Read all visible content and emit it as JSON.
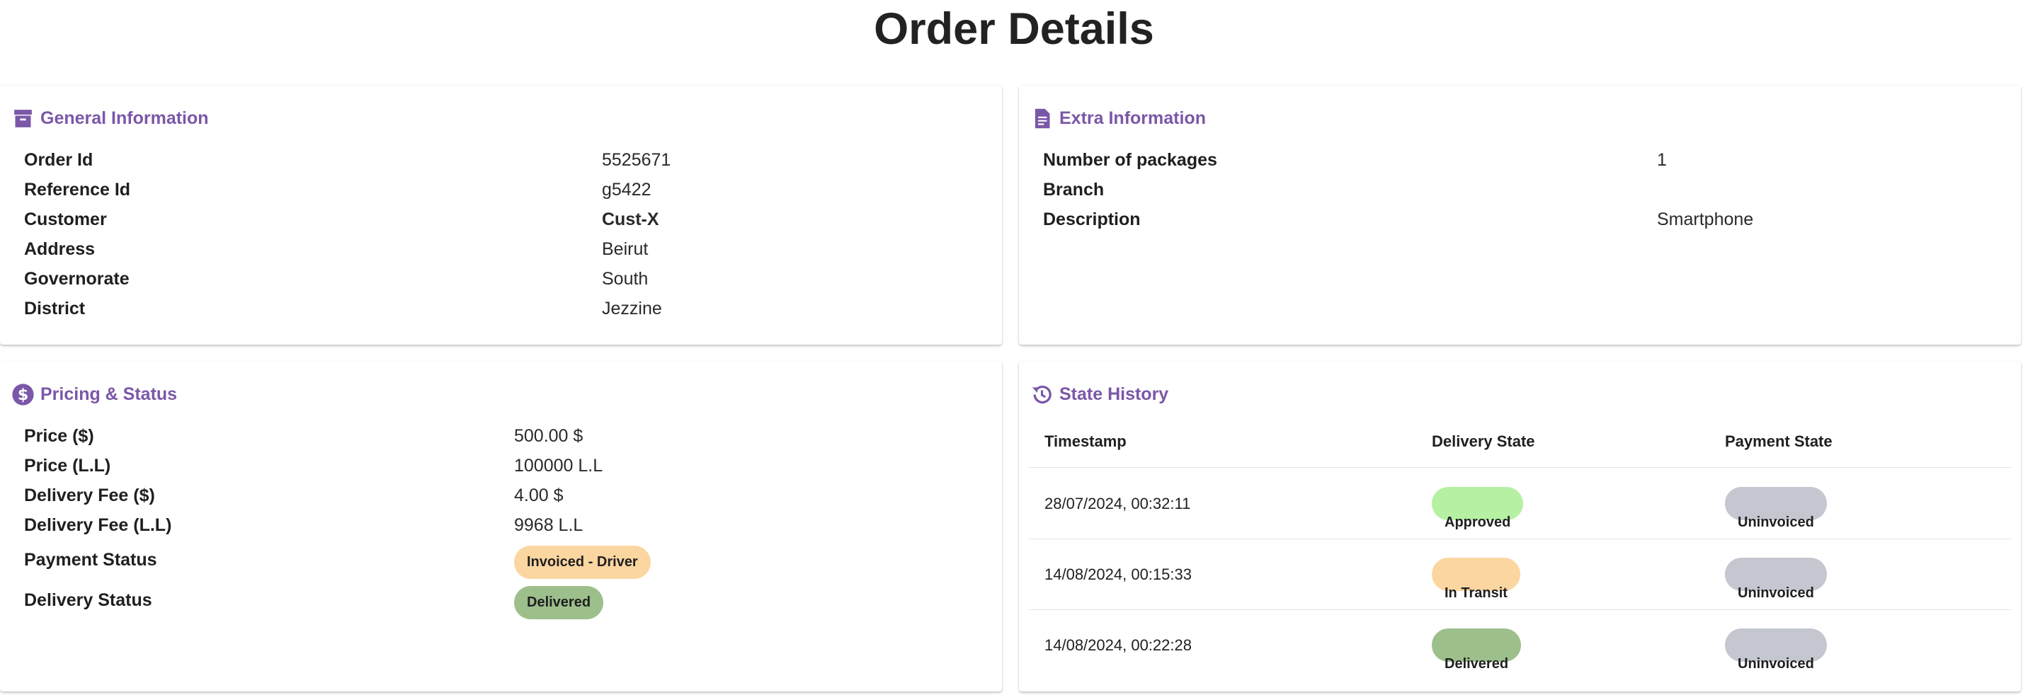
{
  "title": "Order Details",
  "colors": {
    "accent": "#7b57a8",
    "pill_invoiced_driver": "#fcd6a1",
    "pill_delivered": "#9dbf8c",
    "pill_approved": "#b5f0a3",
    "pill_in_transit": "#fcd6a1",
    "pill_uninvoiced": "#c4c7cf"
  },
  "general": {
    "heading": "General Information",
    "icon": "archive-box-icon",
    "rows": [
      {
        "label": "Order Id",
        "value": "5525671"
      },
      {
        "label": "Reference Id",
        "value": "g5422"
      },
      {
        "label": "Customer",
        "value": "Cust-X"
      },
      {
        "label": "Address",
        "value": "Beirut"
      },
      {
        "label": "Governorate",
        "value": "South"
      },
      {
        "label": "District",
        "value": "Jezzine"
      }
    ]
  },
  "extra": {
    "heading": "Extra Information",
    "icon": "document-icon",
    "rows": [
      {
        "label": "Number of packages",
        "value": "1"
      },
      {
        "label": "Branch",
        "value": ""
      },
      {
        "label": "Description",
        "value": "Smartphone"
      }
    ]
  },
  "pricing": {
    "heading": "Pricing & Status",
    "icon": "dollar-circle-icon",
    "rows": [
      {
        "label": "Price ($)",
        "value": "500.00 $"
      },
      {
        "label": "Price (L.L)",
        "value": "100000 L.L"
      },
      {
        "label": "Delivery Fee ($)",
        "value": "4.00 $"
      },
      {
        "label": "Delivery Fee (L.L)",
        "value": "9968 L.L"
      }
    ],
    "payment_status_label": "Payment Status",
    "payment_status_value": "Invoiced - Driver",
    "delivery_status_label": "Delivery Status",
    "delivery_status_value": "Delivered"
  },
  "history": {
    "heading": "State History",
    "icon": "history-icon",
    "columns": [
      "Timestamp",
      "Delivery State",
      "Payment State"
    ],
    "rows": [
      {
        "timestamp": "28/07/2024, 00:32:11",
        "delivery": "Approved",
        "payment": "Uninvoiced"
      },
      {
        "timestamp": "14/08/2024, 00:15:33",
        "delivery": "In Transit",
        "payment": "Uninvoiced"
      },
      {
        "timestamp": "14/08/2024, 00:22:28",
        "delivery": "Delivered",
        "payment": "Uninvoiced"
      }
    ]
  }
}
